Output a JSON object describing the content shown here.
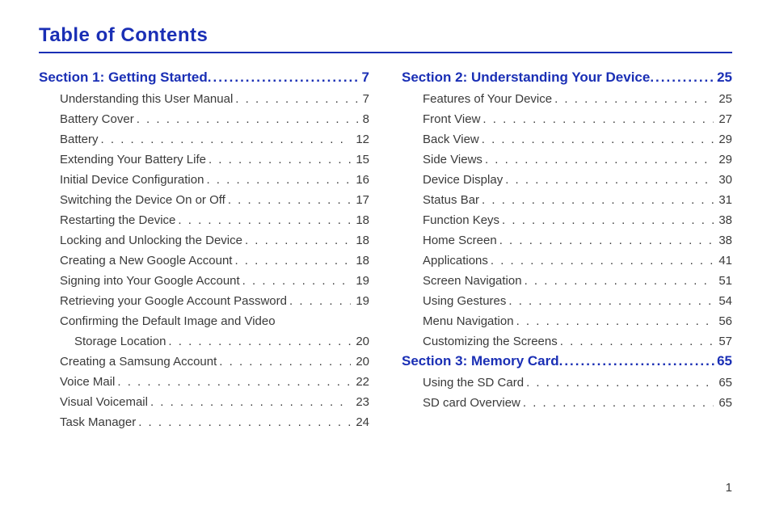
{
  "title": "Table of Contents",
  "page_number": "1",
  "left": {
    "section": {
      "label": "Section 1:  Getting Started ",
      "page": "7"
    },
    "entries": [
      {
        "label": "Understanding this User Manual",
        "page": "7"
      },
      {
        "label": "Battery Cover",
        "page": "8"
      },
      {
        "label": "Battery",
        "page": "12"
      },
      {
        "label": "Extending Your Battery Life ",
        "page": "15"
      },
      {
        "label": "Initial Device Configuration",
        "page": "16"
      },
      {
        "label": "Switching the Device On or Off",
        "page": "17"
      },
      {
        "label": "Restarting the Device",
        "page": "18"
      },
      {
        "label": "Locking and Unlocking the Device ",
        "page": "18"
      },
      {
        "label": "Creating a New Google Account",
        "page": "18"
      },
      {
        "label": "Signing into Your Google Account",
        "page": "19"
      },
      {
        "label": "Retrieving your Google Account Password ",
        "page": "19"
      }
    ],
    "multi": {
      "line1": "Confirming the Default Image and Video",
      "line2": "Storage Location ",
      "page": "20"
    },
    "entries2": [
      {
        "label": "Creating a Samsung Account",
        "page": "20"
      },
      {
        "label": "Voice Mail ",
        "page": "22"
      },
      {
        "label": "Visual Voicemail",
        "page": "23"
      },
      {
        "label": "Task Manager ",
        "page": "24"
      }
    ]
  },
  "right": {
    "section2": {
      "label": "Section 2:  Understanding Your Device ",
      "page": "25"
    },
    "entries2": [
      {
        "label": "Features of Your Device ",
        "page": "25"
      },
      {
        "label": "Front View ",
        "page": "27"
      },
      {
        "label": "Back View ",
        "page": "29"
      },
      {
        "label": "Side Views ",
        "page": "29"
      },
      {
        "label": "Device Display ",
        "page": "30"
      },
      {
        "label": "Status Bar ",
        "page": "31"
      },
      {
        "label": "Function Keys",
        "page": "38"
      },
      {
        "label": "Home Screen ",
        "page": "38"
      },
      {
        "label": "Applications ",
        "page": "41"
      },
      {
        "label": "Screen Navigation ",
        "page": "51"
      },
      {
        "label": "Using Gestures",
        "page": "54"
      },
      {
        "label": "Menu Navigation ",
        "page": "56"
      },
      {
        "label": "Customizing the Screens ",
        "page": "57"
      }
    ],
    "section3": {
      "label": "Section 3:  Memory Card ",
      "page": "65"
    },
    "entries3": [
      {
        "label": "Using the SD Card ",
        "page": "65"
      },
      {
        "label": "SD card Overview",
        "page": "65"
      }
    ]
  }
}
